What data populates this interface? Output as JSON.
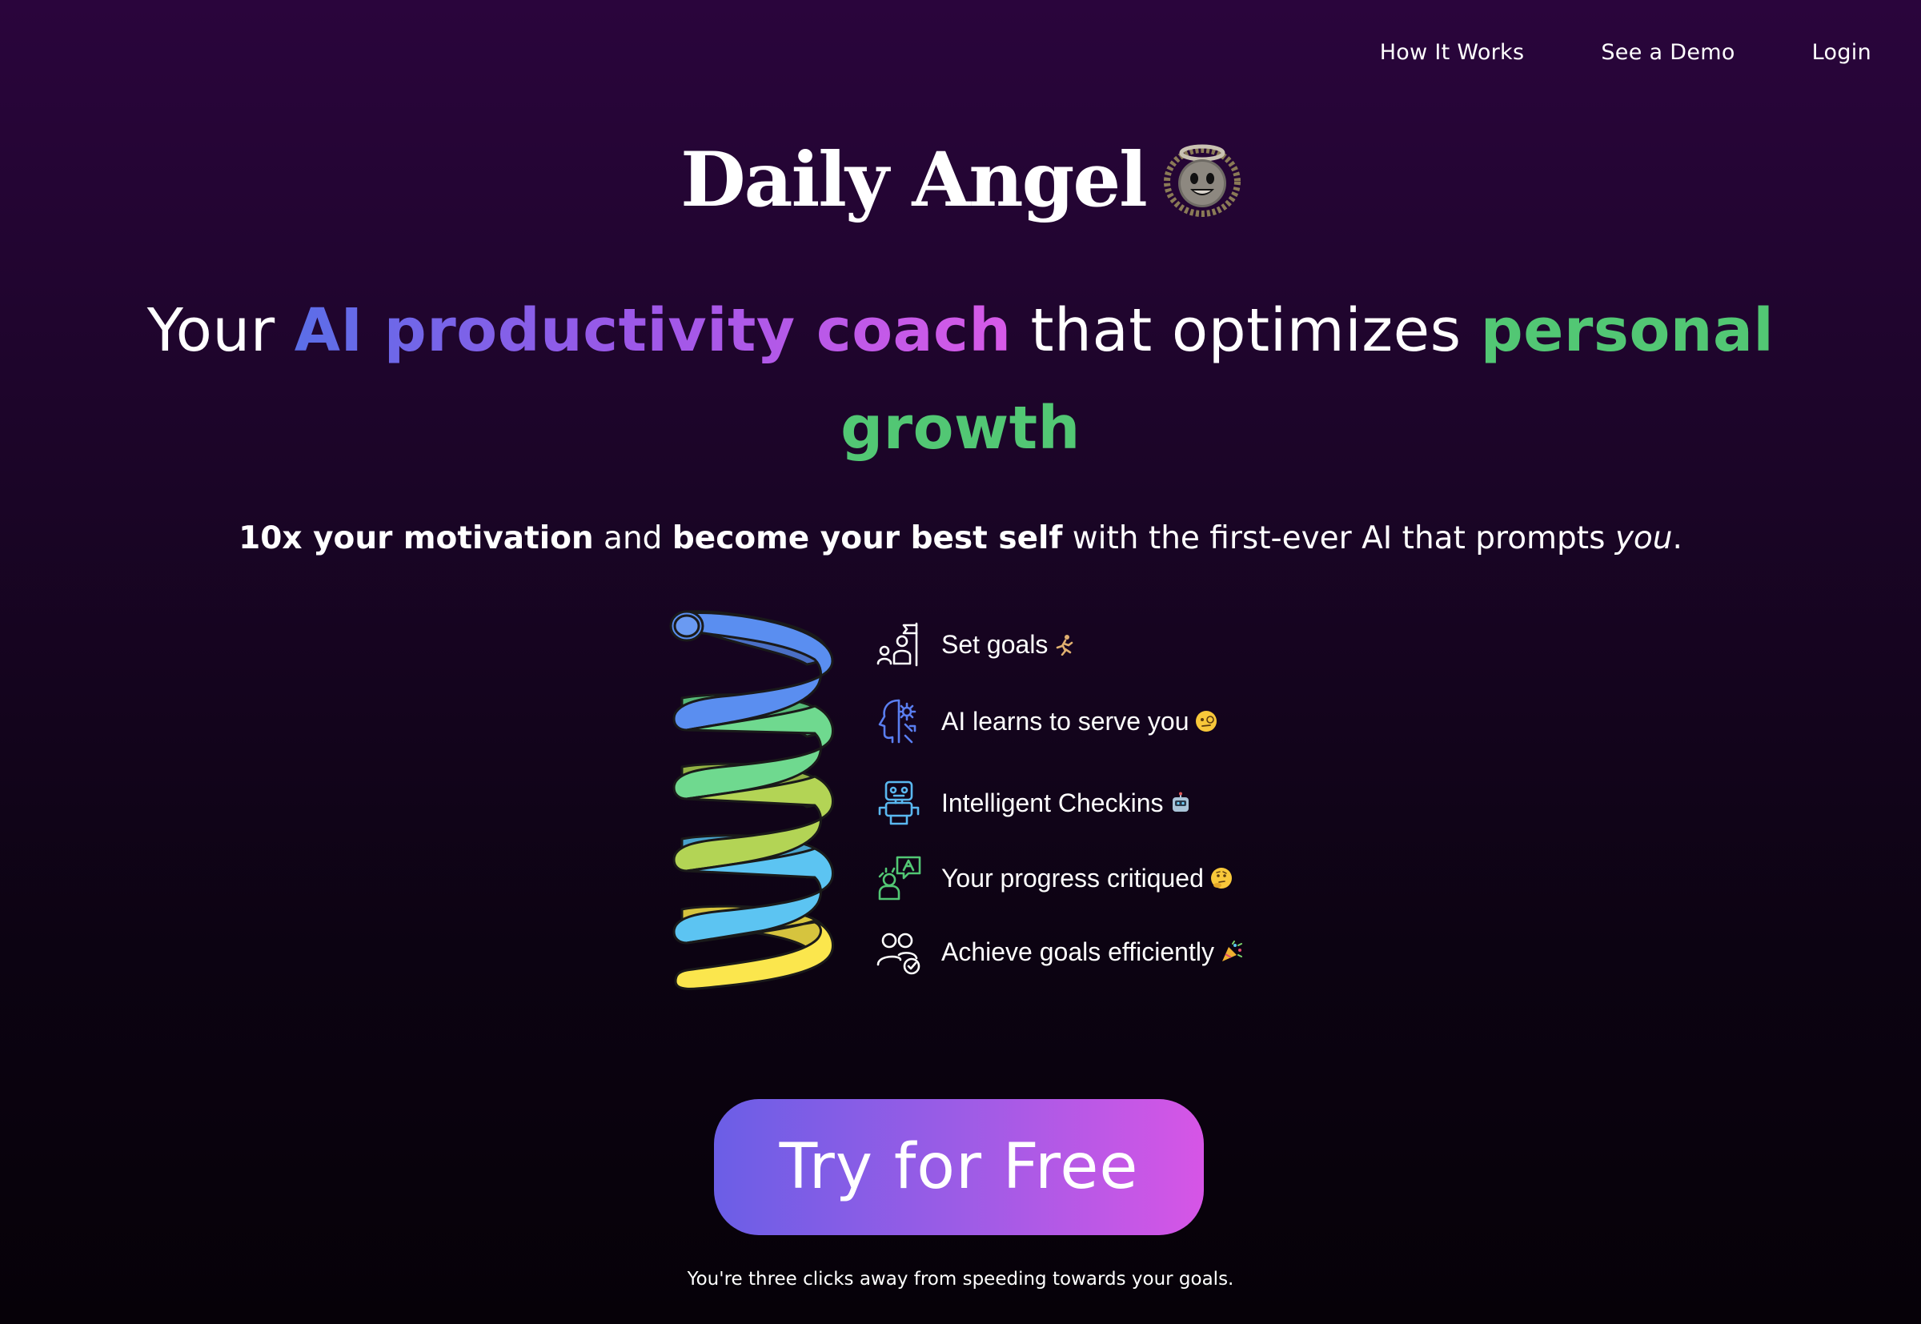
{
  "nav": {
    "items": [
      {
        "label": "How It Works"
      },
      {
        "label": "See a Demo"
      },
      {
        "label": "Login"
      }
    ]
  },
  "brand": {
    "name": "Daily Angel",
    "icon": "smiling-face-with-halo-icon"
  },
  "headline": {
    "part1": "Your ",
    "highlight1": "AI productivity coach",
    "part2": " that optimizes ",
    "highlight2": "personal growth"
  },
  "subhead": {
    "bold1": "10x your motivation",
    "text1": " and ",
    "bold2": "become your best self",
    "text2": " with the first-ever AI that prompts ",
    "italic": "you",
    "text3": "."
  },
  "features": [
    {
      "label": "Set goals",
      "icon": "goal-flag-icon",
      "emoji": "running-person-icon"
    },
    {
      "label": "AI learns to serve you",
      "icon": "ai-brain-gear-icon",
      "emoji": "face-with-monocle-icon"
    },
    {
      "label": "Intelligent Checkins",
      "icon": "robot-icon",
      "emoji": "robot-face-icon"
    },
    {
      "label": "Your progress critiqued",
      "icon": "chat-critique-icon",
      "emoji": "thinking-face-icon"
    },
    {
      "label": "Achieve goals efficiently",
      "icon": "people-check-icon",
      "emoji": "party-popper-icon"
    }
  ],
  "cta": {
    "label": "Try for Free"
  },
  "footnote": "You're three clicks away from speeding towards your goals.",
  "colors": {
    "background_top": "#2a053c",
    "background_bottom": "#060108",
    "gradient_start": "#5b6ee8",
    "gradient_end": "#d75ae8",
    "green": "#52c774",
    "spring_blue": "#5a8ef0",
    "spring_green": "#6fd98f",
    "spring_lime": "#b3d455",
    "spring_cyan": "#5cc4f2",
    "spring_yellow": "#fbe64d"
  }
}
